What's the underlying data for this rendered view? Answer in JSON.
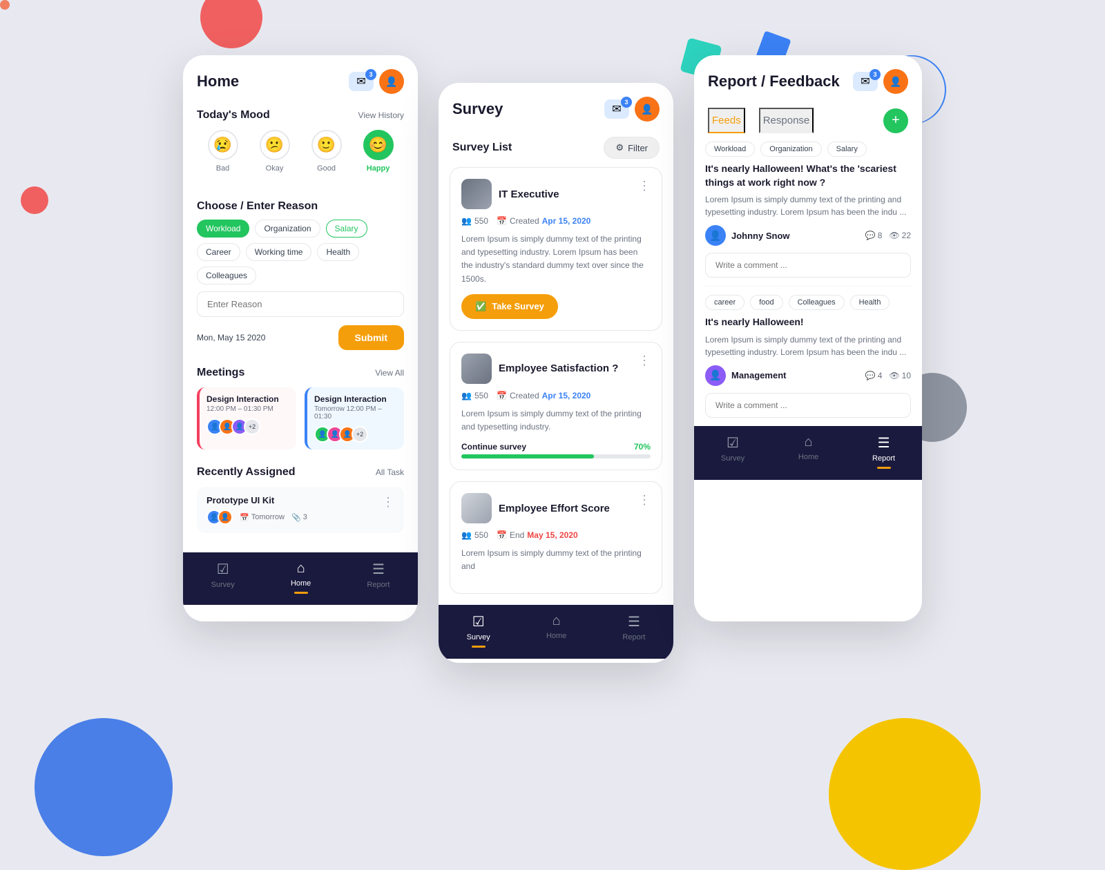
{
  "background": {
    "color": "#e8e9f0"
  },
  "home": {
    "title": "Home",
    "badge": "3",
    "mood": {
      "section_title": "Today's Mood",
      "view_history": "View History",
      "options": [
        {
          "label": "Bad",
          "emoji": "😢",
          "active": false
        },
        {
          "label": "Okay",
          "emoji": "😕",
          "active": false
        },
        {
          "label": "Good",
          "emoji": "🙂",
          "active": false
        },
        {
          "label": "Happy",
          "emoji": "😊",
          "active": true
        }
      ]
    },
    "reason": {
      "title": "Choose / Enter Reason",
      "tags": [
        {
          "label": "Workload",
          "style": "green"
        },
        {
          "label": "Organization",
          "style": "normal"
        },
        {
          "label": "Salary",
          "style": "green-outline"
        },
        {
          "label": "Career",
          "style": "normal"
        },
        {
          "label": "Working time",
          "style": "normal"
        },
        {
          "label": "Health",
          "style": "normal"
        },
        {
          "label": "Colleagues",
          "style": "normal"
        }
      ],
      "input_placeholder": "Enter Reason"
    },
    "date": "Mon, May 15 2020",
    "submit_label": "Submit",
    "meetings": {
      "title": "Meetings",
      "view_all": "View All",
      "items": [
        {
          "title": "Design Interaction",
          "time": "12:00 PM – 01:30 PM",
          "color": "red",
          "extra": "+2"
        },
        {
          "title": "Design Interaction",
          "time": "Tomorrow  12:00 PM – 01:30",
          "color": "blue",
          "extra": "+2"
        }
      ]
    },
    "tasks": {
      "title": "Recently Assigned",
      "all_tasks": "All Task",
      "items": [
        {
          "name": "Prototype UI Kit",
          "due": "Tomorrow",
          "attachments": "3"
        }
      ]
    },
    "nav": {
      "items": [
        {
          "label": "Survey",
          "icon": "☑",
          "active": false
        },
        {
          "label": "Home",
          "icon": "⌂",
          "active": true
        },
        {
          "label": "Report",
          "icon": "≡",
          "active": false
        }
      ]
    }
  },
  "survey": {
    "title": "Survey",
    "badge": "3",
    "list_title": "Survey List",
    "filter_label": "Filter",
    "items": [
      {
        "title": "IT Executive",
        "participants": "550",
        "created_label": "Created",
        "date": "Apr 15, 2020",
        "desc": "Lorem Ipsum is simply dummy text of the printing and typesetting industry. Lorem Ipsum has been the industry's standard dummy text over since the 1500s.",
        "action": "Take Survey",
        "progress": null
      },
      {
        "title": "Employee Satisfaction ?",
        "participants": "550",
        "created_label": "Created",
        "date": "Apr 15, 2020",
        "desc": "Lorem Ipsum is simply dummy text of the printing and typesetting industry.",
        "action": "Continue survey",
        "progress": 70
      },
      {
        "title": "Employee Effort Score",
        "participants": "550",
        "created_label": "End",
        "date": "May 15, 2020",
        "date_red": true,
        "desc": "Lorem Ipsum is simply dummy text of the printing and",
        "action": null,
        "progress": null
      }
    ],
    "nav": {
      "items": [
        {
          "label": "Survey",
          "icon": "☑",
          "active": true
        },
        {
          "label": "Home",
          "icon": "⌂",
          "active": false
        },
        {
          "label": "Report",
          "icon": "≡",
          "active": false
        }
      ]
    }
  },
  "report": {
    "title": "Report / Feedback",
    "badge": "3",
    "tabs": [
      {
        "label": "Feeds",
        "active": true
      },
      {
        "label": "Response",
        "active": false
      }
    ],
    "feeds": [
      {
        "tags": [
          "Workload",
          "Organization",
          "Salary"
        ],
        "title": "It's nearly Halloween! What's the 'scariest things at work right now ?",
        "desc": "Lorem Ipsum is simply dummy text of the printing and typesetting industry. Lorem Ipsum has been the indu ...",
        "author": "Johnny Snow",
        "comments": "8",
        "views": "22",
        "comment_placeholder": "Write a comment ..."
      },
      {
        "tags": [
          "career",
          "food",
          "Colleagues",
          "Health"
        ],
        "title": "It's nearly Halloween!",
        "desc": "Lorem Ipsum is simply dummy text of the printing and typesetting industry. Lorem Ipsum has been the indu ...",
        "author": "Management",
        "comments": "4",
        "views": "10",
        "comment_placeholder": "Write a comment ..."
      }
    ],
    "nav": {
      "items": [
        {
          "label": "Survey",
          "icon": "☑",
          "active": false
        },
        {
          "label": "Home",
          "icon": "⌂",
          "active": false
        },
        {
          "label": "Report",
          "icon": "≡",
          "active": true
        }
      ]
    }
  }
}
